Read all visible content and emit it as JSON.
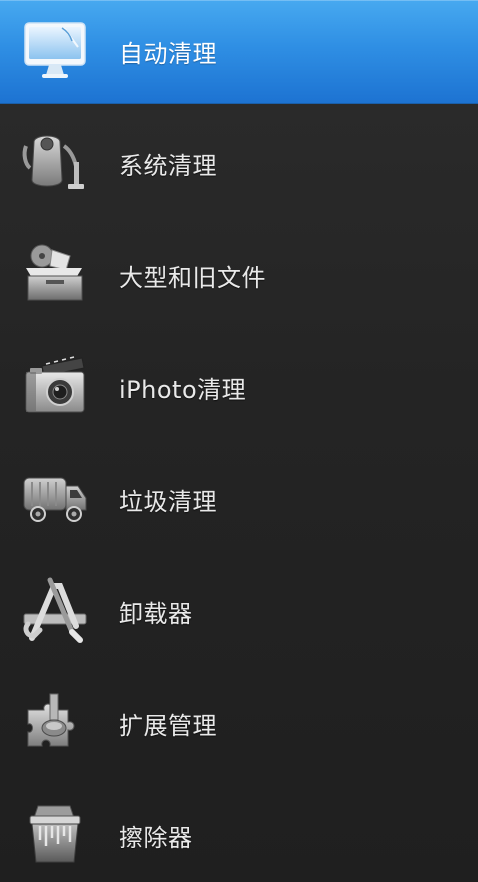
{
  "sidebar": {
    "items": [
      {
        "label": "自动清理",
        "icon": "monitor-icon",
        "selected": true
      },
      {
        "label": "系统清理",
        "icon": "vacuum-icon",
        "selected": false
      },
      {
        "label": "大型和旧文件",
        "icon": "box-icon",
        "selected": false
      },
      {
        "label": "iPhoto清理",
        "icon": "camera-icon",
        "selected": false
      },
      {
        "label": "垃圾清理",
        "icon": "truck-icon",
        "selected": false
      },
      {
        "label": "卸载器",
        "icon": "app-store-tools-icon",
        "selected": false
      },
      {
        "label": "扩展管理",
        "icon": "puzzle-icon",
        "selected": false
      },
      {
        "label": "擦除器",
        "icon": "shredder-icon",
        "selected": false
      }
    ]
  },
  "colors": {
    "selected_background": "#2f8fe4",
    "sidebar_background": "#262626",
    "label_text": "#e9e9e9"
  }
}
